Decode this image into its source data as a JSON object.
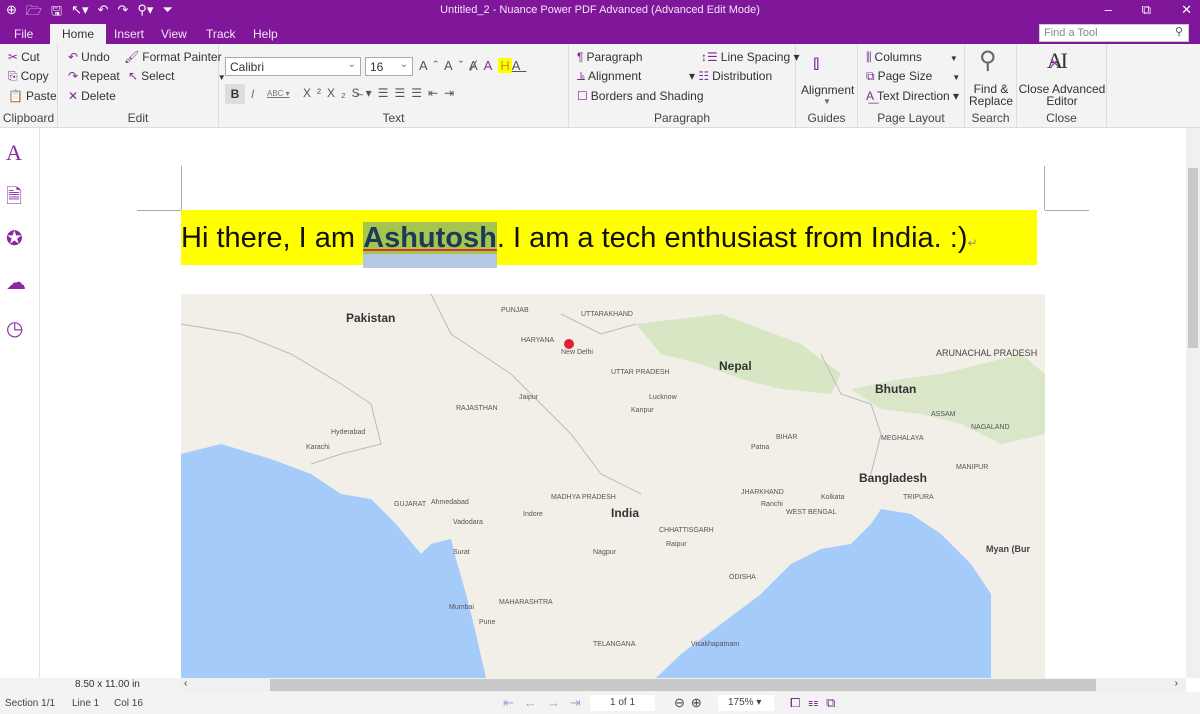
{
  "window": {
    "title": "Untitled_2 - Nuance Power PDF Advanced (Advanced Edit Mode)",
    "minimize": "–",
    "restore": "⧉",
    "close": "✕"
  },
  "qat": [
    "⊕",
    "🗁",
    "🖫",
    "↖▾",
    "↶",
    "↷",
    "⚲▾",
    "⏷"
  ],
  "tabs": [
    {
      "label": "File"
    },
    {
      "label": "Home"
    },
    {
      "label": "Insert"
    },
    {
      "label": "View"
    },
    {
      "label": "Track"
    },
    {
      "label": "Help"
    }
  ],
  "find_tool": {
    "placeholder": "Find a Tool"
  },
  "ribbon": {
    "clipboard": {
      "cut": "Cut",
      "copy": "Copy",
      "paste": "Paste",
      "label": "Clipboard"
    },
    "edit": {
      "undo": "Undo",
      "repeat": "Repeat",
      "delete": "Delete",
      "format_painter": "Format Painter",
      "select": "Select",
      "label": "Edit"
    },
    "text": {
      "font": "Calibri",
      "size": "16",
      "label": "Text",
      "highlight_color": "#ffff00"
    },
    "paragraph": {
      "paragraph": "Paragraph",
      "alignment": "Alignment",
      "borders": "Borders and Shading",
      "line_spacing": "Line Spacing",
      "distribution": "Distribution",
      "label": "Paragraph"
    },
    "guides": {
      "alignment": "Alignment",
      "label": "Guides"
    },
    "page_layout": {
      "columns": "Columns",
      "page_size": "Page Size",
      "text_direction": "Text Direction",
      "label": "Page Layout"
    },
    "search": {
      "find_replace_1": "Find &",
      "find_replace_2": "Replace",
      "label": "Search"
    },
    "close": {
      "close_1": "Close Advanced",
      "close_2": "Editor",
      "label": "Close"
    }
  },
  "document": {
    "text_before": "Hi there, I am ",
    "text_selected": "Ashutosh",
    "text_after": ". I am a tech enthusiast from India. :)",
    "para_mark": "↵",
    "map_labels": {
      "pakistan": "Pakistan",
      "nepal": "Nepal",
      "bhutan": "Bhutan",
      "bangladesh": "Bangladesh",
      "india": "India",
      "rajasthan": "RAJASTHAN",
      "uttar_pradesh": "UTTAR PRADESH",
      "madhya_pradesh": "MADHYA PRADESH",
      "maharashtra": "MAHARASHTRA",
      "gujarat": "GUJARAT",
      "bihar": "BIHAR",
      "jharkhand": "JHARKHAND",
      "west_bengal": "WEST BENGAL",
      "odisha": "ODISHA",
      "chhattisgarh": "CHHATTISGARH",
      "telangana": "TELANGANA",
      "haryana": "HARYANA",
      "punjab": "PUNJAB",
      "uttarakhand": "UTTARAKHAND",
      "assam": "ASSAM",
      "meghalaya": "MEGHALAYA",
      "nagaland": "NAGALAND",
      "manipur": "MANIPUR",
      "tripura": "TRIPURA",
      "arunachal": "ARUNACHAL PRADESH",
      "new_delhi": "New Delhi",
      "karachi": "Karachi",
      "ahmedabad": "Ahmedabad",
      "mumbai": "Mumbai",
      "pune": "Pune",
      "nagpur": "Nagpur",
      "kolkata": "Kolkata",
      "jaipur": "Jaipur",
      "lucknow": "Lucknow",
      "kanpur": "Kanpur",
      "hyderabad": "Hyderabad",
      "indore": "Indore",
      "surat": "Surat",
      "vadodara": "Vadodara",
      "patna": "Patna",
      "ranchi": "Ranchi",
      "raipur": "Raipur",
      "visakhapatnam": "Visakhapatnam",
      "myanmar": "Myan (Bur"
    }
  },
  "status": {
    "page_size": "8.50 x 11.00 in",
    "section": "Section 1/1",
    "line": "Line 1",
    "col": "Col 16",
    "page": "1 of 1",
    "zoom": "175%"
  },
  "colors": {
    "accent": "#80179a",
    "ribbon": "#f3f3f3",
    "highlight": "#ffff00",
    "selection": "#a6c54f",
    "sea": "#a4cbf9",
    "land": "#f2efe9"
  }
}
